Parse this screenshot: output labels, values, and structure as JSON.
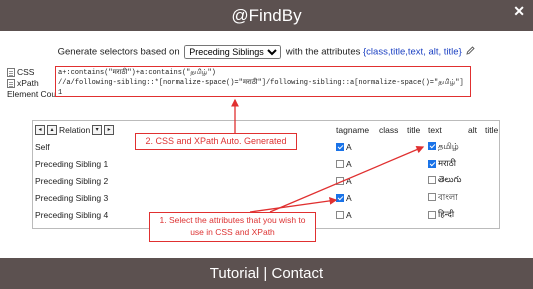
{
  "header": {
    "title": "@FindBy",
    "close_icon": "close-icon"
  },
  "generator": {
    "prefix": "Generate selectors based on",
    "selected_option": "Preceding Siblings",
    "middle": "with the attributes",
    "attributes": "{class,title,text, alt, title}",
    "pencil_icon": "pencil-icon"
  },
  "labels": {
    "css": "CSS",
    "xpath": "xPath",
    "element_count": "Element Count"
  },
  "output": {
    "css": "a+:contains(\"मराठी\")+a:contains(\"தமிழ்\")",
    "xpath": "//a/following-sibling::*[normalize-space()=\"मराठी\"]/following-sibling::a[normalize-space()=\"தமிழ்\"]",
    "count": "1"
  },
  "callouts": {
    "generated": "2. CSS and XPath Auto. Generated",
    "select": "1. Select the attributes that you wish to use in CSS and XPath"
  },
  "table": {
    "relation_header": "Relation",
    "columns": [
      "tagname",
      "class",
      "title",
      "text",
      "alt",
      "title"
    ],
    "rows": [
      {
        "relation": "Self",
        "tag": "A",
        "tag_checked": true,
        "text": "தமிழ்",
        "text_checked": true
      },
      {
        "relation": "Preceding Sibling 1",
        "tag": "A",
        "tag_checked": false,
        "text": "मराठी",
        "text_checked": true
      },
      {
        "relation": "Preceding Sibling 2",
        "tag": "A",
        "tag_checked": false,
        "text": "తెలుగు",
        "text_checked": false
      },
      {
        "relation": "Preceding Sibling 3",
        "tag": "A",
        "tag_checked": true,
        "text": "বাংলা",
        "text_checked": false
      },
      {
        "relation": "Preceding Sibling 4",
        "tag": "A",
        "tag_checked": false,
        "text": "हिन्दी",
        "text_checked": false
      }
    ]
  },
  "footer": {
    "tutorial": "Tutorial",
    "separator": "|",
    "contact": "Contact"
  },
  "colors": {
    "header_bg": "#5c5150",
    "accent_red": "#e03030",
    "link_blue": "#1a3fc2",
    "check_blue": "#1a73e8"
  }
}
